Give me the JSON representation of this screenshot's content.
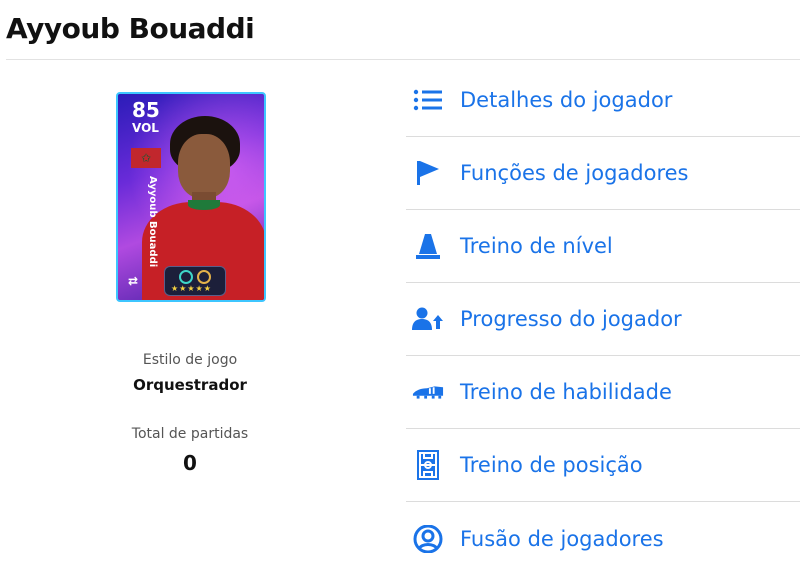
{
  "player": {
    "name": "Ayyoub Bouaddi",
    "card": {
      "rating": "85",
      "position": "VOL",
      "vertical_name": "Ayyoub Bouaddi",
      "stars": "★★★★★"
    },
    "stats": [
      {
        "label": "Estilo de jogo",
        "value": "Orquestrador"
      },
      {
        "label": "Total de partidas",
        "value": "0"
      }
    ]
  },
  "menu": {
    "items": [
      {
        "label": "Detalhes do jogador",
        "icon": "list-icon"
      },
      {
        "label": "Funções de jogadores",
        "icon": "flag-icon"
      },
      {
        "label": "Treino de nível",
        "icon": "cone-icon"
      },
      {
        "label": "Progresso do jogador",
        "icon": "person-up-icon"
      },
      {
        "label": "Treino de habilidade",
        "icon": "boot-icon"
      },
      {
        "label": "Treino de posição",
        "icon": "pitch-icon"
      },
      {
        "label": "Fusão de jogadores",
        "icon": "user-circle-icon"
      }
    ]
  },
  "colors": {
    "accent": "#1a73e8"
  }
}
